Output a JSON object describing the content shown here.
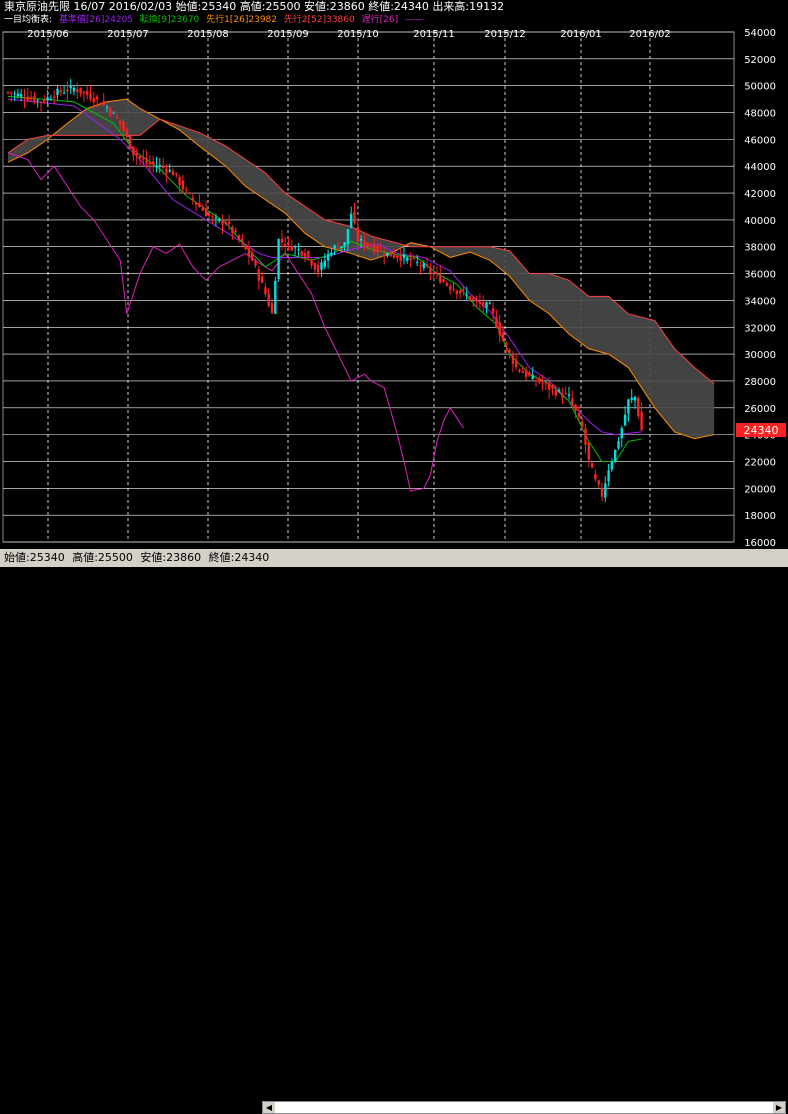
{
  "header": {
    "symbol": "東京原油先限",
    "contract": "16/07",
    "date": "2016/02/03",
    "open": "始値:25340",
    "high": "高値:25500",
    "low": "安値:23860",
    "close": "終値:24340",
    "volume": "出来高:19132"
  },
  "legend": {
    "title": "一目均衡表:",
    "kijun": "基準値[26]24205",
    "tenkan": "転換[9]23670",
    "senko1": "先行1[26]23982",
    "senko2": "先行2[52]33860",
    "chikou": "遅行[26]"
  },
  "colors": {
    "background": "#000000",
    "grid": "#ffffff",
    "kijun": "#a020f0",
    "tenkan": "#00c000",
    "senko1": "#ff8c00",
    "senko2": "#ff4040",
    "chikou": "#e020c0",
    "cloud": "#4a4a4a",
    "candle_up": "#00e0e0",
    "candle_down": "#ff2020",
    "price_tag": "#ff2020"
  },
  "current_price": "24340",
  "status": {
    "open": "始値:25340",
    "high": "高値:25500",
    "low": "安値:23860",
    "close": "終値:24340"
  },
  "chart_data": {
    "type": "candlestick",
    "x_labels": [
      "2015/06",
      "2015/07",
      "2015/08",
      "2015/09",
      "2015/10",
      "2015/11",
      "2015/12",
      "2016/01",
      "2016/02"
    ],
    "y_ticks": [
      16000,
      18000,
      20000,
      22000,
      24000,
      26000,
      28000,
      30000,
      32000,
      34000,
      36000,
      38000,
      40000,
      42000,
      44000,
      46000,
      48000,
      50000,
      52000,
      54000
    ],
    "ylim": [
      16000,
      54000
    ],
    "grid": true,
    "price_path": [
      [
        0,
        49500
      ],
      [
        5,
        49200
      ],
      [
        10,
        48800
      ],
      [
        15,
        49500
      ],
      [
        20,
        49800
      ],
      [
        25,
        49200
      ],
      [
        30,
        48400
      ],
      [
        34,
        47200
      ],
      [
        38,
        45000
      ],
      [
        42,
        44200
      ],
      [
        46,
        44000
      ],
      [
        50,
        43500
      ],
      [
        54,
        42000
      ],
      [
        58,
        41000
      ],
      [
        62,
        40000
      ],
      [
        66,
        39800
      ],
      [
        70,
        38500
      ],
      [
        74,
        37000
      ],
      [
        78,
        34500
      ],
      [
        80,
        33000
      ],
      [
        82,
        38500
      ],
      [
        86,
        38000
      ],
      [
        90,
        37500
      ],
      [
        94,
        36200
      ],
      [
        98,
        37800
      ],
      [
        102,
        38200
      ],
      [
        104,
        40500
      ],
      [
        106,
        38500
      ],
      [
        110,
        38000
      ],
      [
        114,
        37500
      ],
      [
        118,
        37300
      ],
      [
        122,
        37000
      ],
      [
        126,
        36500
      ],
      [
        130,
        35800
      ],
      [
        134,
        35000
      ],
      [
        138,
        34500
      ],
      [
        142,
        33800
      ],
      [
        146,
        33500
      ],
      [
        150,
        31000
      ],
      [
        154,
        29000
      ],
      [
        158,
        28300
      ],
      [
        162,
        27800
      ],
      [
        166,
        27200
      ],
      [
        170,
        26800
      ],
      [
        174,
        24500
      ],
      [
        176,
        22000
      ],
      [
        178,
        20500
      ],
      [
        180,
        19500
      ],
      [
        182,
        21500
      ],
      [
        184,
        22800
      ],
      [
        186,
        24500
      ],
      [
        188,
        26500
      ],
      [
        190,
        26800
      ],
      [
        192,
        24300
      ]
    ],
    "kijun_path": [
      [
        0,
        49000
      ],
      [
        20,
        48500
      ],
      [
        34,
        46000
      ],
      [
        40,
        44500
      ],
      [
        50,
        41500
      ],
      [
        60,
        40000
      ],
      [
        70,
        38500
      ],
      [
        76,
        37500
      ],
      [
        80,
        37200
      ],
      [
        96,
        37200
      ],
      [
        104,
        37800
      ],
      [
        112,
        38200
      ],
      [
        118,
        37500
      ],
      [
        126,
        37200
      ],
      [
        134,
        36200
      ],
      [
        140,
        34500
      ],
      [
        146,
        33200
      ],
      [
        152,
        31200
      ],
      [
        158,
        29000
      ],
      [
        164,
        28000
      ],
      [
        170,
        26500
      ],
      [
        176,
        25000
      ],
      [
        180,
        24200
      ],
      [
        184,
        24000
      ],
      [
        192,
        24205
      ]
    ],
    "tenkan_path": [
      [
        0,
        49200
      ],
      [
        20,
        48800
      ],
      [
        32,
        47200
      ],
      [
        38,
        45200
      ],
      [
        46,
        43800
      ],
      [
        54,
        41800
      ],
      [
        60,
        40800
      ],
      [
        66,
        39800
      ],
      [
        72,
        38000
      ],
      [
        78,
        36500
      ],
      [
        84,
        37500
      ],
      [
        92,
        37000
      ],
      [
        98,
        37400
      ],
      [
        104,
        38400
      ],
      [
        110,
        37800
      ],
      [
        118,
        37400
      ],
      [
        124,
        37200
      ],
      [
        130,
        36000
      ],
      [
        136,
        35200
      ],
      [
        142,
        33500
      ],
      [
        148,
        32200
      ],
      [
        152,
        30000
      ],
      [
        158,
        28500
      ],
      [
        164,
        27800
      ],
      [
        170,
        26500
      ],
      [
        176,
        23500
      ],
      [
        180,
        22000
      ],
      [
        184,
        22000
      ],
      [
        188,
        23500
      ],
      [
        192,
        23670
      ]
    ],
    "senko1_path": [
      [
        0,
        44300
      ],
      [
        6,
        45000
      ],
      [
        12,
        46000
      ],
      [
        18,
        47200
      ],
      [
        24,
        48300
      ],
      [
        30,
        48800
      ],
      [
        36,
        49000
      ],
      [
        40,
        48300
      ],
      [
        46,
        47500
      ],
      [
        52,
        46700
      ],
      [
        58,
        45500
      ],
      [
        66,
        44000
      ],
      [
        72,
        42500
      ],
      [
        78,
        41500
      ],
      [
        84,
        40500
      ],
      [
        90,
        39000
      ],
      [
        96,
        38000
      ],
      [
        104,
        37500
      ],
      [
        110,
        37000
      ],
      [
        116,
        37500
      ],
      [
        122,
        38300
      ],
      [
        128,
        38000
      ],
      [
        134,
        37200
      ],
      [
        140,
        37600
      ],
      [
        146,
        37000
      ],
      [
        152,
        35800
      ],
      [
        158,
        34000
      ],
      [
        164,
        33000
      ],
      [
        170,
        31500
      ],
      [
        176,
        30400
      ],
      [
        182,
        30000
      ],
      [
        188,
        29000
      ],
      [
        196,
        26000
      ],
      [
        202,
        24200
      ],
      [
        208,
        23700
      ],
      [
        214,
        24000
      ]
    ],
    "senko2_path": [
      [
        0,
        45000
      ],
      [
        6,
        46000
      ],
      [
        12,
        46300
      ],
      [
        18,
        46300
      ],
      [
        24,
        46300
      ],
      [
        30,
        46300
      ],
      [
        36,
        46300
      ],
      [
        40,
        46300
      ],
      [
        46,
        47500
      ],
      [
        52,
        47000
      ],
      [
        58,
        46500
      ],
      [
        66,
        45500
      ],
      [
        72,
        44500
      ],
      [
        78,
        43500
      ],
      [
        84,
        42000
      ],
      [
        90,
        41000
      ],
      [
        96,
        40000
      ],
      [
        104,
        39500
      ],
      [
        110,
        38800
      ],
      [
        116,
        38400
      ],
      [
        122,
        38000
      ],
      [
        128,
        38000
      ],
      [
        134,
        38000
      ],
      [
        140,
        38000
      ],
      [
        146,
        38000
      ],
      [
        152,
        37700
      ],
      [
        158,
        36000
      ],
      [
        164,
        36000
      ],
      [
        170,
        35500
      ],
      [
        176,
        34300
      ],
      [
        182,
        34300
      ],
      [
        188,
        33000
      ],
      [
        196,
        32500
      ],
      [
        202,
        30400
      ],
      [
        208,
        29000
      ],
      [
        214,
        27800
      ]
    ],
    "chikou_path": [
      [
        0,
        45000
      ],
      [
        6,
        44500
      ],
      [
        10,
        43000
      ],
      [
        14,
        44000
      ],
      [
        18,
        42500
      ],
      [
        22,
        41000
      ],
      [
        26,
        40000
      ],
      [
        30,
        38500
      ],
      [
        34,
        37000
      ],
      [
        36,
        33000
      ],
      [
        40,
        36000
      ],
      [
        44,
        38000
      ],
      [
        48,
        37500
      ],
      [
        52,
        38200
      ],
      [
        56,
        36500
      ],
      [
        60,
        35500
      ],
      [
        64,
        36500
      ],
      [
        68,
        37000
      ],
      [
        72,
        37500
      ],
      [
        76,
        36800
      ],
      [
        80,
        36200
      ],
      [
        84,
        37500
      ],
      [
        88,
        36000
      ],
      [
        92,
        34500
      ],
      [
        96,
        32000
      ],
      [
        100,
        30000
      ],
      [
        104,
        28000
      ],
      [
        108,
        28500
      ],
      [
        110,
        28000
      ],
      [
        114,
        27500
      ],
      [
        118,
        24000
      ],
      [
        120,
        22000
      ],
      [
        122,
        19800
      ],
      [
        126,
        20000
      ],
      [
        128,
        21000
      ],
      [
        130,
        23500
      ],
      [
        132,
        25000
      ],
      [
        134,
        26000
      ],
      [
        138,
        24500
      ]
    ]
  }
}
